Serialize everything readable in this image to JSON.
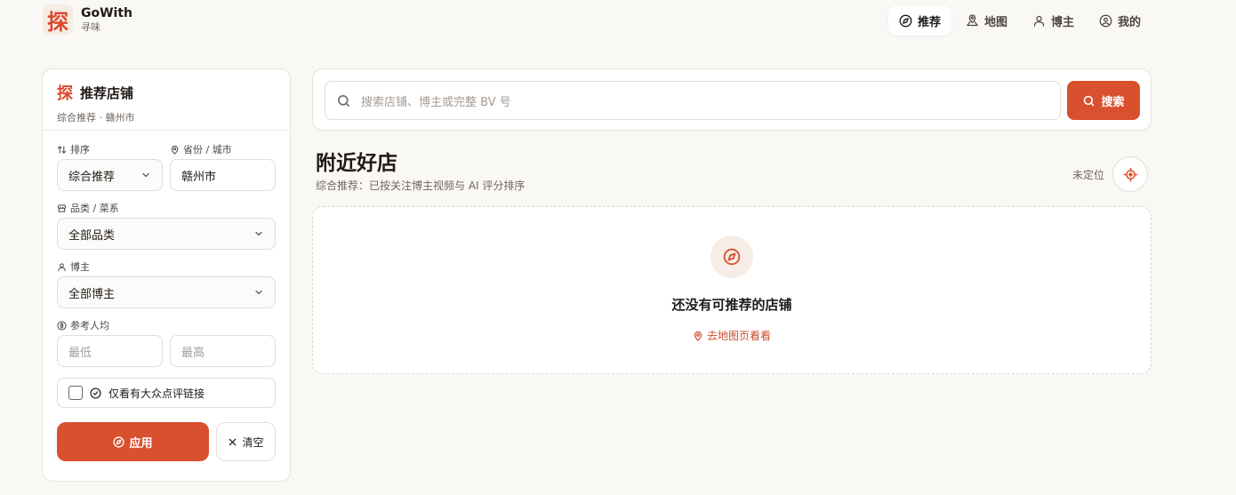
{
  "brand": {
    "mark": "探",
    "name": "GoWith",
    "subtitle": "寻味"
  },
  "nav": {
    "items": [
      {
        "label": "推荐",
        "icon": "compass-icon",
        "active": true
      },
      {
        "label": "地图",
        "icon": "map-pin-icon",
        "active": false
      },
      {
        "label": "博主",
        "icon": "user-icon",
        "active": false
      },
      {
        "label": "我的",
        "icon": "user-circle-icon",
        "active": false
      }
    ]
  },
  "sidebar": {
    "mark": "探",
    "title": "推荐店铺",
    "subtitle": "综合推荐 · 赣州市",
    "sort": {
      "label": "排序",
      "value": "综合推荐"
    },
    "city": {
      "label": "省份 / 城市",
      "value": "赣州市"
    },
    "category": {
      "label": "品类 / 菜系",
      "value": "全部品类"
    },
    "blogger": {
      "label": "博主",
      "value": "全部博主"
    },
    "price": {
      "label": "参考人均",
      "min_placeholder": "最低",
      "max_placeholder": "最高"
    },
    "dianping_only": {
      "label": "仅看有大众点评链接",
      "checked": false
    },
    "apply_label": "应用",
    "clear_label": "清空"
  },
  "search": {
    "placeholder": "搜索店铺、博主或完整 BV 号",
    "button_label": "搜索"
  },
  "section": {
    "title": "附近好店",
    "subtitle": "综合推荐：已按关注博主视频与 AI 评分排序",
    "location_status": "未定位"
  },
  "empty_state": {
    "title": "还没有可推荐的店铺",
    "link_label": "去地图页看看"
  },
  "colors": {
    "accent": "#d9502f",
    "background": "#faf8f4",
    "text": "#1f1a17"
  }
}
